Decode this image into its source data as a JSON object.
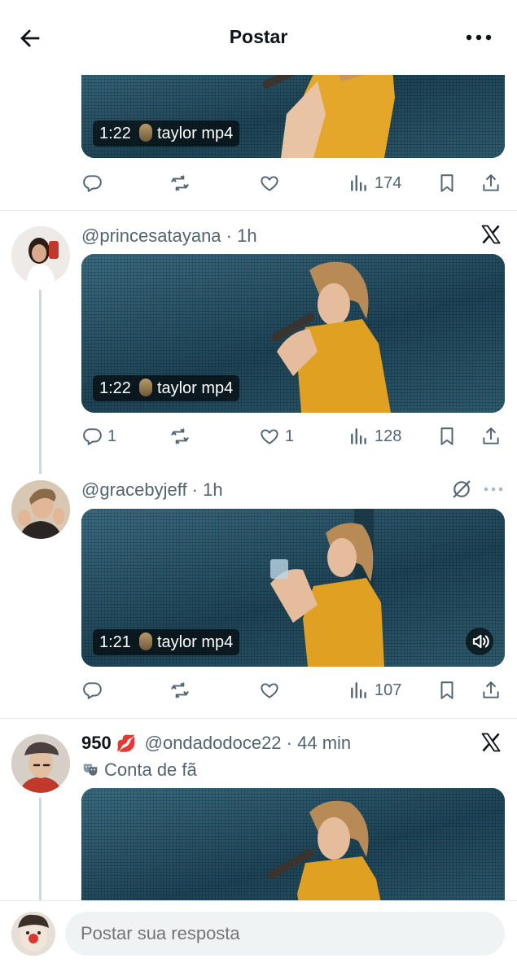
{
  "header": {
    "title": "Postar",
    "back_icon": "arrow-left-icon",
    "more_icon": "more-horizontal-icon"
  },
  "posts": [
    {
      "media": {
        "duration": "1:22",
        "caption": "taylor mp4"
      },
      "actions": {
        "replies": "",
        "reposts": "",
        "likes": "",
        "views": "174"
      }
    },
    {
      "handle": "@princesatayana",
      "time": "1h",
      "media": {
        "duration": "1:22",
        "caption": "taylor mp4"
      },
      "actions": {
        "replies": "1",
        "reposts": "",
        "likes": "1",
        "views": "128"
      }
    },
    {
      "handle": "@gracebyjeff",
      "time": "1h",
      "media": {
        "duration": "1:21",
        "caption": "taylor mp4"
      },
      "actions": {
        "replies": "",
        "reposts": "",
        "likes": "",
        "views": "107"
      }
    },
    {
      "display_name": "950",
      "name_emoji": "💋",
      "handle": "@ondadodoce22",
      "time": "44 min",
      "badge": "Conta de fã"
    }
  ],
  "reply": {
    "placeholder": "Postar sua resposta"
  },
  "colors": {
    "text": "#0f1419",
    "muted": "#536471",
    "divider": "#e6e9ec",
    "input_bg": "#eff3f4",
    "dress": "#e0a021"
  }
}
